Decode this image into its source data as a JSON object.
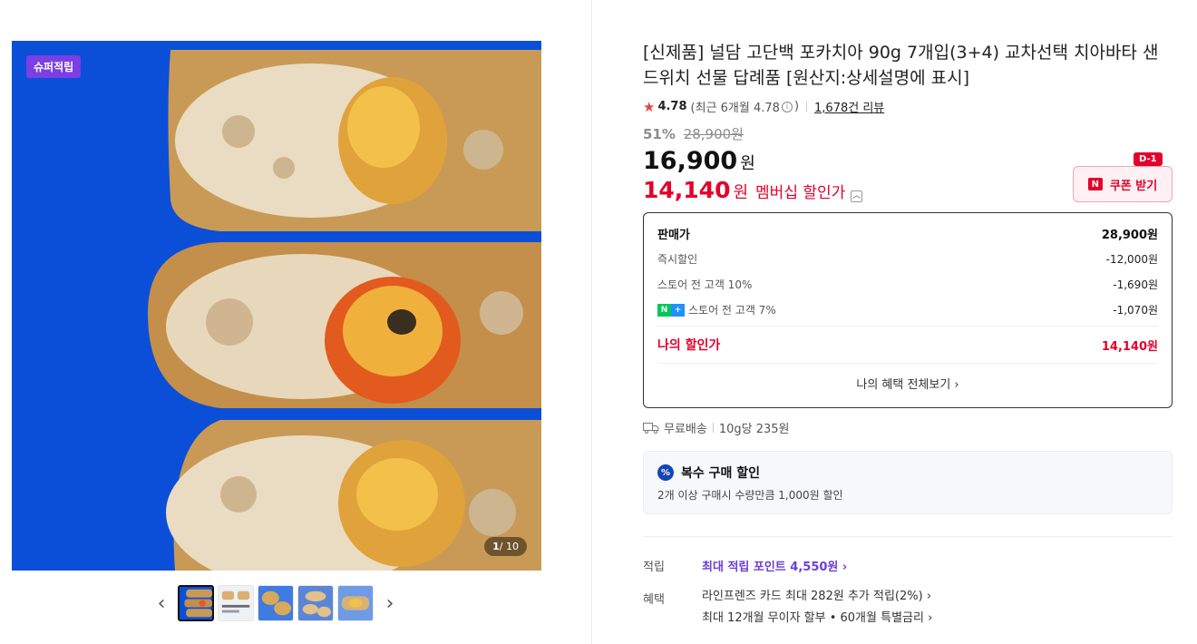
{
  "gallery": {
    "badge": "슈퍼적립",
    "counter_current": "1",
    "counter_total": "/ 10",
    "prev_arrow": "‹",
    "next_arrow": "›",
    "thumbnails": [
      "thumb-1",
      "thumb-2",
      "thumb-3",
      "thumb-4",
      "thumb-5"
    ],
    "colors": {
      "background": "#0b4fd8",
      "bread": "#c99a55",
      "filling": "#e6a21b"
    }
  },
  "product": {
    "title": "[신제품] 널담 고단백 포카치아 90g 7개입(3+4) 교차선택 치아바타 샌드위치 선물 답례품 [원산지:상세설명에 표시]",
    "rating": "4.78",
    "rating_recent": "(최근 6개월 4.78",
    "rating_recent_close": ")",
    "reviews": "1,678건 리뷰",
    "discount_pct": "51%",
    "original_price": "28,900원",
    "price": "16,900",
    "price_unit": "원",
    "member_price": "14,140",
    "member_unit": "원",
    "member_label": "멤버십 할인가"
  },
  "coupon": {
    "icon": "N",
    "label": "쿠폰 받기",
    "dday": "D-1"
  },
  "price_box": {
    "rows": [
      {
        "label": "판매가",
        "amount": "28,900원"
      },
      {
        "label": "즉시할인",
        "amount": "-12,000원"
      },
      {
        "label": "스토어 전 고객 10%",
        "amount": "-1,690원"
      },
      {
        "label": "스토어 전 고객 7%",
        "amount": "-1,070원"
      }
    ],
    "npay_n": "N",
    "npay_plus": "+",
    "my_label": "나의 할인가",
    "my_amount": "14,140원",
    "view_all": "나의 혜택 전체보기 ›"
  },
  "shipping": {
    "label": "무료배송",
    "unit_price": "10g당 235원"
  },
  "multi_discount": {
    "icon": "%",
    "title": "복수 구매 할인",
    "desc": "2개 이상 구매시 수량만큼 1,000원 할인"
  },
  "benefits": {
    "points_label": "적립",
    "points_value": "최대 적립 포인트 4,550원 ›",
    "benefit_label": "혜택",
    "benefit_line1": "라인프렌즈 카드 최대 282원 추가 적립(2%) ›",
    "benefit_line2": "최대 12개월 무이자 할부 • 60개월 특별금리 ›"
  }
}
